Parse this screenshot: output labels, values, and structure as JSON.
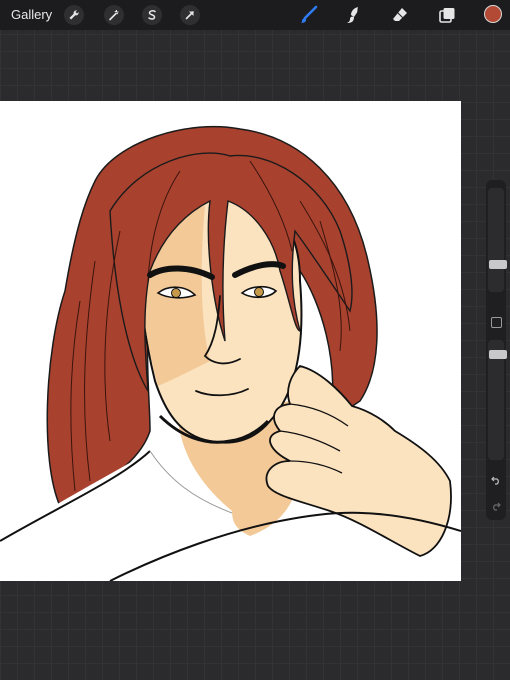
{
  "toolbar": {
    "gallery_label": "Gallery",
    "left_tools": [
      "wrench-icon",
      "magic-wand-icon",
      "selection-icon",
      "transform-arrow-icon"
    ],
    "right_tools": [
      "brush-icon",
      "smudge-icon",
      "eraser-icon",
      "layers-icon"
    ],
    "active_tool": "brush-icon",
    "current_color": "#b24a35",
    "accent_color": "#2f7cf6"
  },
  "sidebar": {
    "brush_size_level": 0.3,
    "opacity_level": 0.55,
    "controls": [
      "undo-icon",
      "redo-icon"
    ]
  },
  "canvas": {
    "artwork": "portrait-illustration"
  },
  "colors": {
    "hair": "#a9412f",
    "skin": "#fbe3c0",
    "skin_shadow": "#f3c997",
    "line": "#111111",
    "shirt": "#ffffff"
  }
}
